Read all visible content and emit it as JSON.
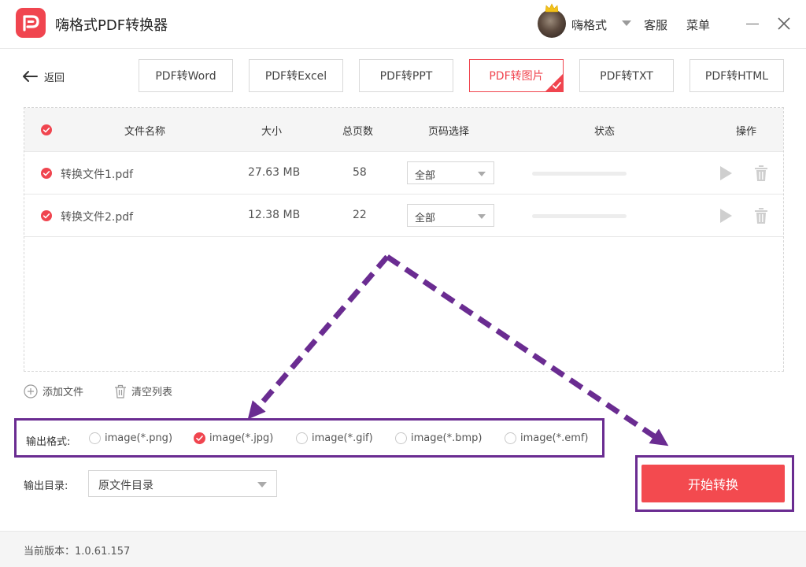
{
  "app": {
    "title": "嗨格式PDF转换器",
    "username": "嗨格式",
    "service_label": "客服",
    "menu_label": "菜单"
  },
  "nav": {
    "back_label": "返回",
    "tabs": [
      {
        "label": "PDF转Word",
        "active": false
      },
      {
        "label": "PDF转Excel",
        "active": false
      },
      {
        "label": "PDF转PPT",
        "active": false
      },
      {
        "label": "PDF转图片",
        "active": true
      },
      {
        "label": "PDF转TXT",
        "active": false
      },
      {
        "label": "PDF转HTML",
        "active": false
      }
    ]
  },
  "table": {
    "headers": {
      "name": "文件名称",
      "size": "大小",
      "pages": "总页数",
      "page_select": "页码选择",
      "status": "状态",
      "actions": "操作"
    },
    "rows": [
      {
        "name": "转换文件1.pdf",
        "size": "27.63 MB",
        "pages": "58",
        "page_select": "全部",
        "progress": 0
      },
      {
        "name": "转换文件2.pdf",
        "size": "12.38 MB",
        "pages": "22",
        "page_select": "全部",
        "progress": 0
      }
    ]
  },
  "tools": {
    "add_file": "添加文件",
    "clear_list": "清空列表"
  },
  "output": {
    "format_label": "输出格式:",
    "formats": [
      {
        "label": "image(*.png)",
        "selected": false
      },
      {
        "label": "image(*.jpg)",
        "selected": true
      },
      {
        "label": "image(*.gif)",
        "selected": false
      },
      {
        "label": "image(*.bmp)",
        "selected": false
      },
      {
        "label": "image(*.emf)",
        "selected": false
      }
    ],
    "dir_label": "输出目录:",
    "dir_value": "原文件目录"
  },
  "actions": {
    "start_label": "开始转换"
  },
  "footer": {
    "version": "当前版本：1.0.61.157"
  },
  "colors": {
    "accent": "#f0454f",
    "annotation": "#6a2c91"
  }
}
